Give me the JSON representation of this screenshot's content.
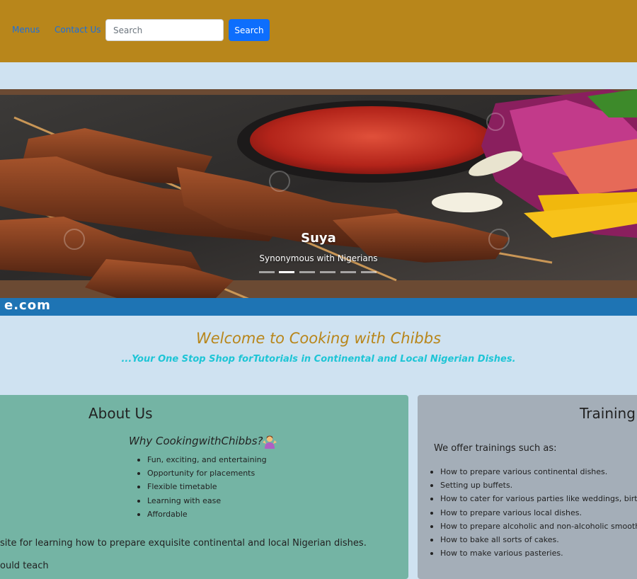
{
  "nav": {
    "links": [
      "Menus",
      "Contact Us"
    ],
    "search_placeholder": "Search",
    "search_button": "Search",
    "bar_color": "#b8861b"
  },
  "carousel": {
    "slide_title": "Suya",
    "slide_caption": "Synonymous with Nigerians",
    "watermark": "e.com",
    "indicator_count": 6,
    "active_indicator": 1
  },
  "welcome": {
    "title": "Welcome to Cooking with Chibbs",
    "subtitle": "...Your One Stop Shop forTutorials in Continental and Local Nigerian Dishes."
  },
  "about": {
    "title": "About Us",
    "why_heading": "Why CookingwithChibbs?",
    "why_emoji": "person-shrugging-icon",
    "items": [
      "Fun, exciting, and entertaining",
      "Opportunity for placements",
      "Flexible timetable",
      "Learning with ease",
      "Affordable"
    ],
    "paragraph1": "site for learning how to prepare exquisite continental and local Nigerian dishes.",
    "paragraph2": "ould teach ",
    "card_color": "#74b4a4"
  },
  "training": {
    "title": "Training",
    "intro": "We offer trainings such as:",
    "items": [
      "How to prepare various continental dishes.",
      "Setting up buffets.",
      "How to cater for various parties like weddings, birthd",
      "How to prepare various local dishes.",
      "How to prepare alcoholic and non-alcoholic smoothie",
      "How to bake all sorts of cakes.",
      "How to make various pasteries."
    ],
    "card_color": "#a4aeb8"
  },
  "colors": {
    "background": "#cfe2f1",
    "accent_gold": "#b8861b",
    "accent_cyan": "#1ec5d6",
    "primary_blue": "#0d6efd"
  }
}
